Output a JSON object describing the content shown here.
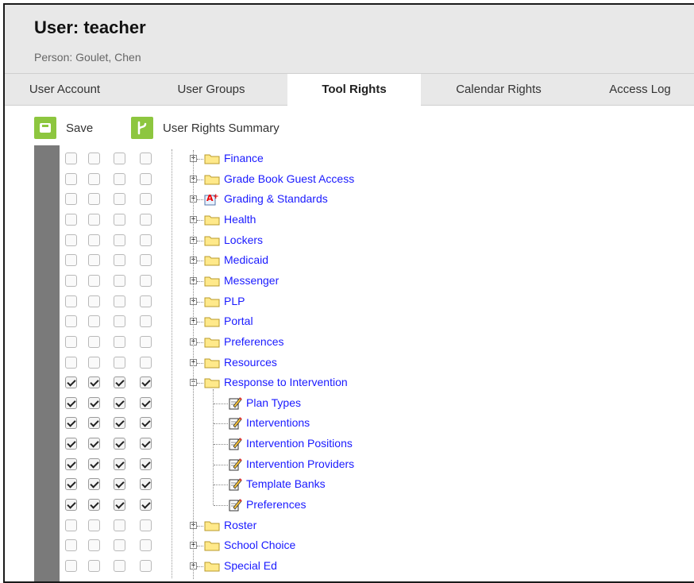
{
  "header": {
    "title": "User: teacher",
    "subtitle": "Person: Goulet, Chen"
  },
  "tabs": [
    {
      "label": "User Account",
      "active": false
    },
    {
      "label": "User Groups",
      "active": false
    },
    {
      "label": "Tool Rights",
      "active": true
    },
    {
      "label": "Calendar Rights",
      "active": false
    },
    {
      "label": "Access Log",
      "active": false
    }
  ],
  "toolbar": {
    "save_label": "Save",
    "save_icon": "save-icon",
    "summary_label": "User Rights Summary",
    "summary_icon": "branch-icon",
    "accent_color": "#8dc63f"
  },
  "tree": [
    {
      "label": "Finance",
      "type": "folder",
      "expanded": false,
      "rights": [
        false,
        false,
        false,
        false
      ]
    },
    {
      "label": "Grade Book Guest Access",
      "type": "folder",
      "expanded": false,
      "rights": [
        false,
        false,
        false,
        false
      ]
    },
    {
      "label": "Grading & Standards",
      "type": "grading",
      "expanded": false,
      "rights": [
        false,
        false,
        false,
        false
      ]
    },
    {
      "label": "Health",
      "type": "folder",
      "expanded": false,
      "rights": [
        false,
        false,
        false,
        false
      ]
    },
    {
      "label": "Lockers",
      "type": "folder",
      "expanded": false,
      "rights": [
        false,
        false,
        false,
        false
      ]
    },
    {
      "label": "Medicaid",
      "type": "folder",
      "expanded": false,
      "rights": [
        false,
        false,
        false,
        false
      ]
    },
    {
      "label": "Messenger",
      "type": "folder",
      "expanded": false,
      "rights": [
        false,
        false,
        false,
        false
      ]
    },
    {
      "label": "PLP",
      "type": "folder",
      "expanded": false,
      "rights": [
        false,
        false,
        false,
        false
      ]
    },
    {
      "label": "Portal",
      "type": "folder",
      "expanded": false,
      "rights": [
        false,
        false,
        false,
        false
      ]
    },
    {
      "label": "Preferences",
      "type": "folder",
      "expanded": false,
      "rights": [
        false,
        false,
        false,
        false
      ]
    },
    {
      "label": "Resources",
      "type": "folder",
      "expanded": false,
      "rights": [
        false,
        false,
        false,
        false
      ]
    },
    {
      "label": "Response to Intervention",
      "type": "folder",
      "expanded": true,
      "rights": [
        true,
        true,
        true,
        true
      ]
    },
    {
      "label": "Plan Types",
      "type": "tool",
      "child": true,
      "rights": [
        true,
        true,
        true,
        true
      ]
    },
    {
      "label": "Interventions",
      "type": "tool",
      "child": true,
      "rights": [
        true,
        true,
        true,
        true
      ]
    },
    {
      "label": "Intervention Positions",
      "type": "tool",
      "child": true,
      "rights": [
        true,
        true,
        true,
        true
      ]
    },
    {
      "label": "Intervention Providers",
      "type": "tool",
      "child": true,
      "rights": [
        true,
        true,
        true,
        true
      ]
    },
    {
      "label": "Template Banks",
      "type": "tool",
      "child": true,
      "rights": [
        true,
        true,
        true,
        true
      ]
    },
    {
      "label": "Preferences",
      "type": "tool",
      "child": true,
      "rights": [
        true,
        true,
        true,
        true
      ]
    },
    {
      "label": "Roster",
      "type": "folder",
      "expanded": false,
      "rights": [
        false,
        false,
        false,
        false
      ]
    },
    {
      "label": "School Choice",
      "type": "folder",
      "expanded": false,
      "rights": [
        false,
        false,
        false,
        false
      ]
    },
    {
      "label": "Special Ed",
      "type": "folder",
      "expanded": false,
      "rights": [
        false,
        false,
        false,
        false
      ]
    }
  ]
}
